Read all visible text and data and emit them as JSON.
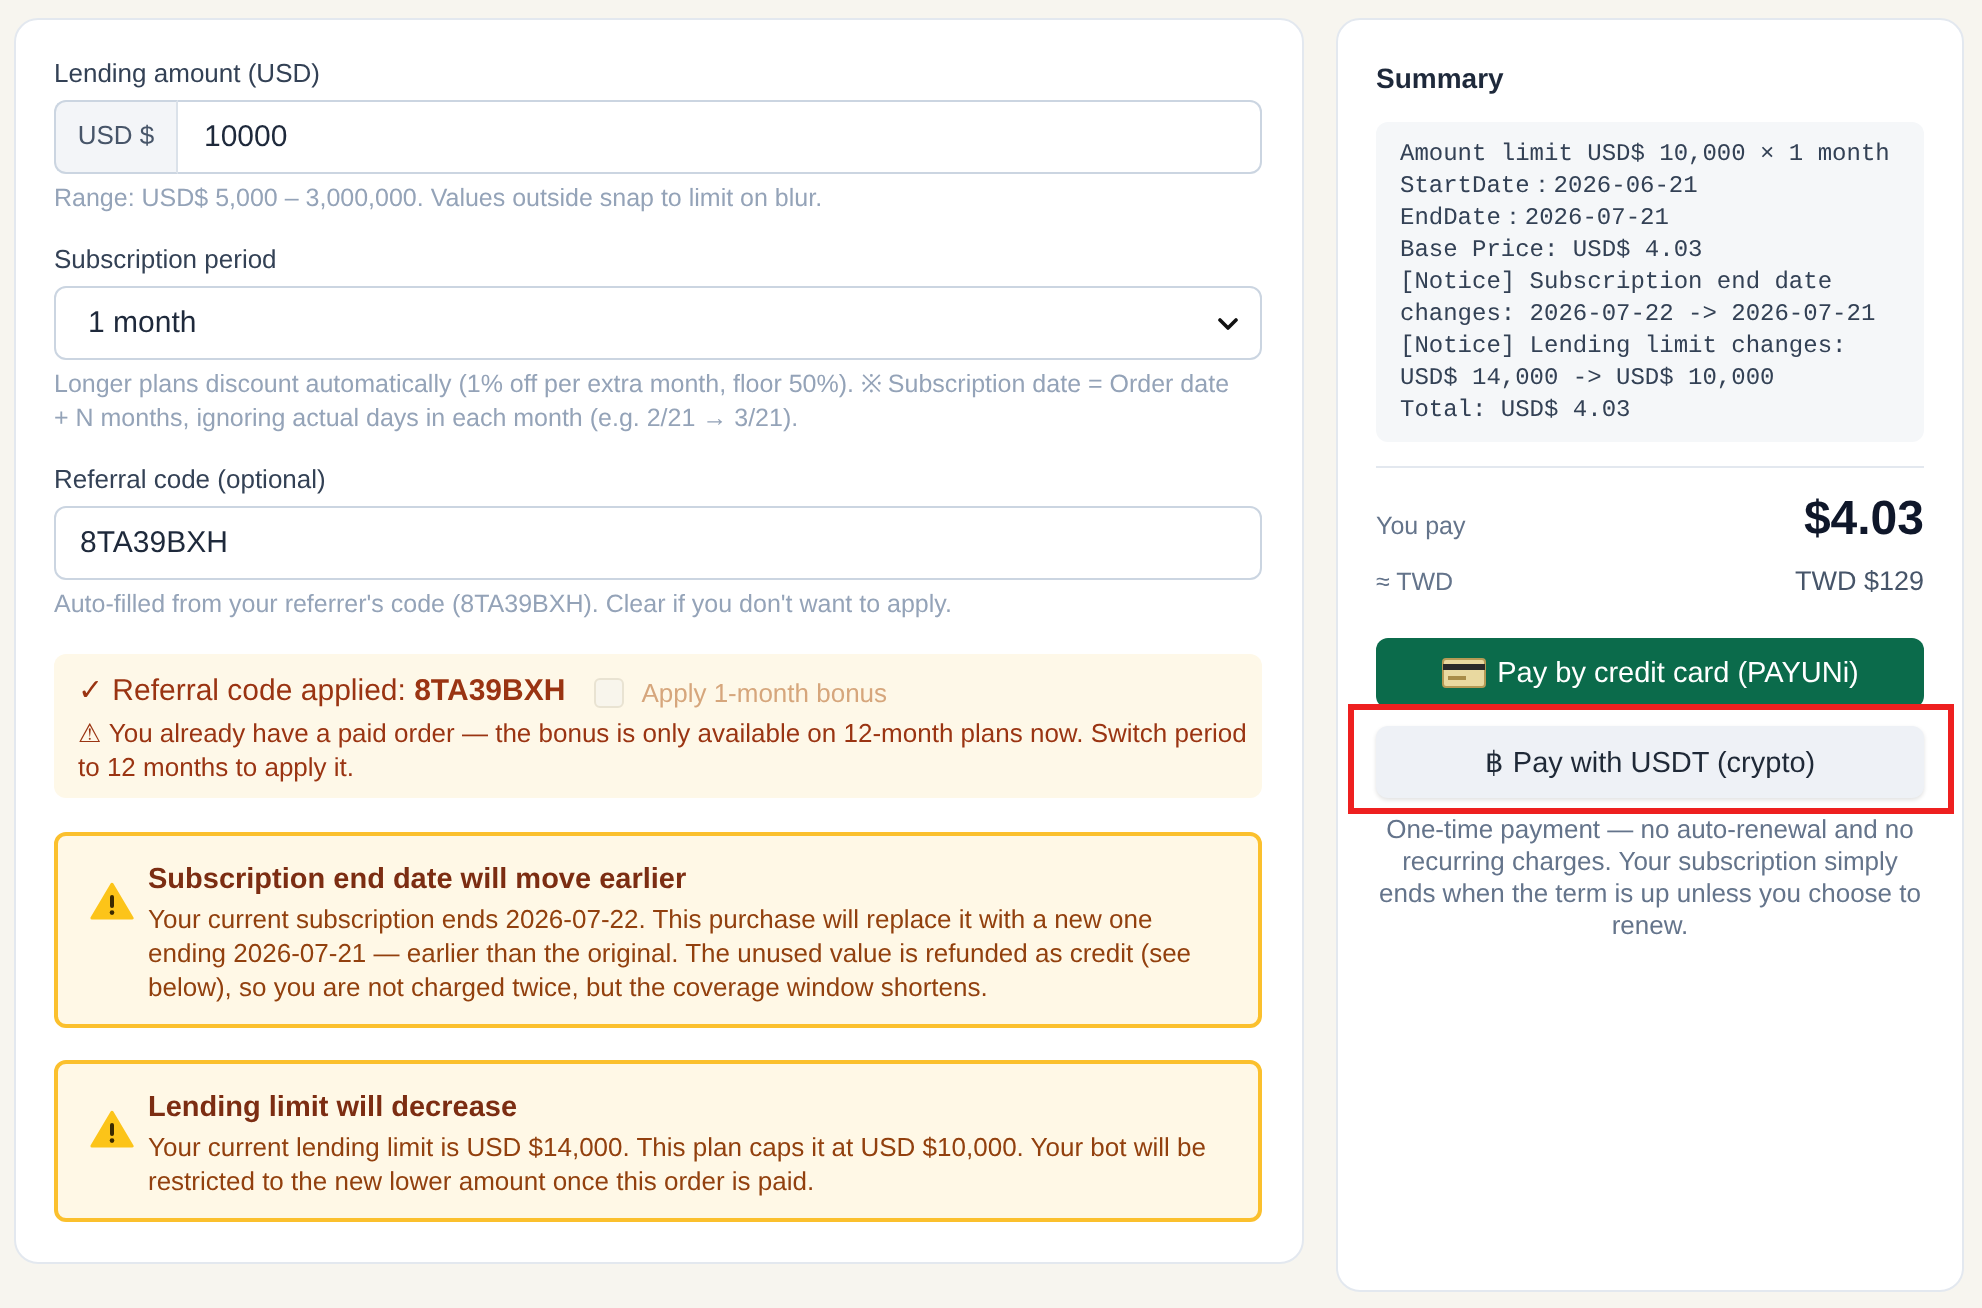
{
  "amount_field": {
    "label": "Lending amount (USD)",
    "prefix": "USD $",
    "value": "10000",
    "hint": "Range: USD$ 5,000 – 3,000,000. Values outside snap to limit on blur."
  },
  "period_field": {
    "label": "Subscription period",
    "value": "1 month",
    "hint": "Longer plans discount automatically (1% off per extra month, floor 50%). ※ Subscription date = Order date + N months, ignoring actual days in each month (e.g. 2/21 → 3/21)."
  },
  "referral_field": {
    "label": "Referral code (optional)",
    "value": "8TA39BXH",
    "hint": "Auto-filled from your referrer's code (8TA39BXH). Clear if you don't want to apply."
  },
  "referral_notice": {
    "status": "✓ Referral code applied: **8TA39BXH**",
    "bonus": {
      "label": "Apply 1-month bonus",
      "checked": false,
      "disabled": true
    },
    "message": "⚠ You already have a paid order — the bonus is only available on 12-month plans now. Switch period to 12 months to apply it."
  },
  "warnings": [
    {
      "title": "Subscription end date will move earlier",
      "body": "Your current subscription ends 2026-07-22. This purchase will replace it with a new one ending 2026-07-21 — earlier than the original. The unused value is refunded as credit (see below), so you are not charged twice, but the coverage window shortens."
    },
    {
      "title": "Lending limit will decrease",
      "body": "Your current lending limit is USD $14,000. This plan caps it at USD $10,000. Your bot will be restricted to the new lower amount once this order is paid."
    }
  ],
  "summary": {
    "title": "Summary",
    "lines": [
      "Amount limit USD$ 10,000 × 1 month",
      "StartDate：2026-06-21",
      "EndDate：2026-07-21",
      "Base Price: USD$ 4.03",
      "[Notice] Subscription end date changes: 2026-07-22 -> 2026-07-21",
      "[Notice] Lending limit changes: USD$ 14,000 -> USD$ 10,000",
      "Total: USD$ 4.03"
    ],
    "you_pay_label": "You pay",
    "you_pay_amount": "$4.03",
    "twd_label": "≈ TWD",
    "twd_amount": "TWD $129"
  },
  "payment_buttons": [
    {
      "kind": "card",
      "label": "Pay by credit card (PAYUNi)",
      "highlighted": false
    },
    {
      "kind": "crypto",
      "label": "฿ Pay with USDT (crypto)",
      "highlighted": true
    }
  ],
  "payment_note": "One-time payment — no auto-renewal and no recurring charges. Your subscription simply ends when the term is up unless you choose to renew."
}
